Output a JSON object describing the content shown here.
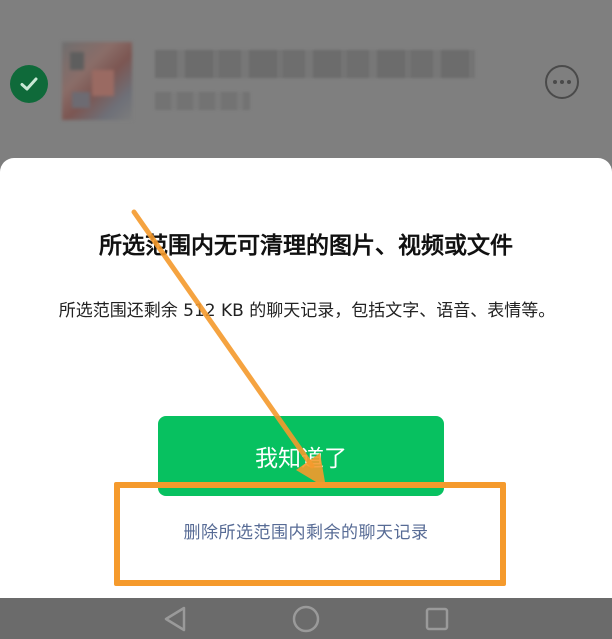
{
  "dialog": {
    "title": "所选范围内无可清理的图片、视频或文件",
    "description": "所选范围还剩余 512 KB 的聊天记录，包括文字、语音、表情等。",
    "primary_button": "我知道了",
    "delete_link": "删除所选范围内剩余的聊天记录"
  },
  "background_row": {
    "selected": true,
    "title": "",
    "subtitle": ""
  },
  "icons": {
    "check": "check-circle-icon",
    "more": "more-options-icon",
    "back": "back-triangle-icon",
    "home": "home-circle-icon",
    "recents": "recents-square-icon"
  },
  "colors": {
    "accent_green": "#07c160",
    "link_blue": "#576b95",
    "annotation_orange": "#f59a2c"
  }
}
